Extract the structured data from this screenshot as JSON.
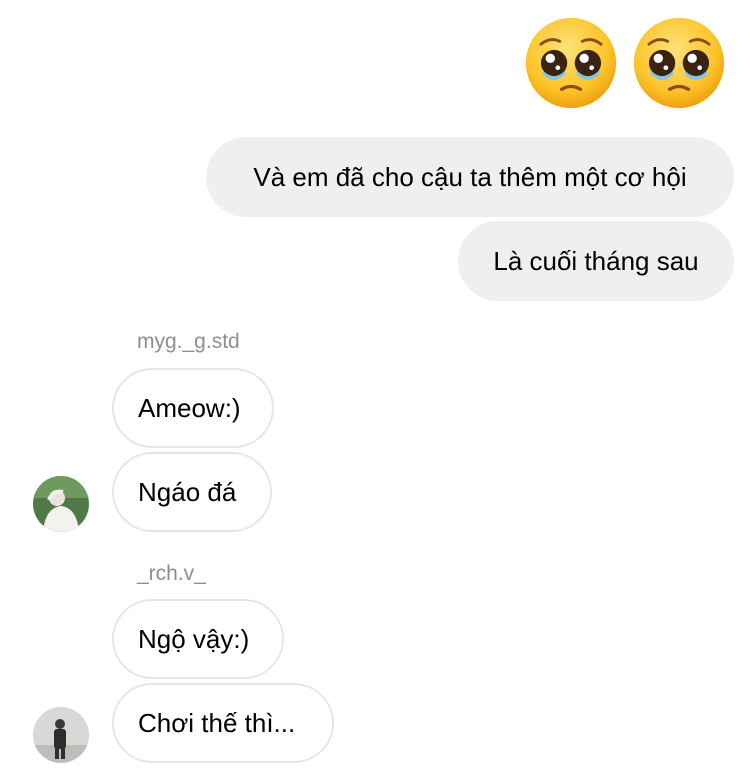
{
  "reactions": {
    "emoji_icons": [
      "pleading-face-icon",
      "pleading-face-icon"
    ]
  },
  "messages": {
    "sent": [
      {
        "text": "Và em đã cho cậu ta thêm một cơ hội"
      },
      {
        "text": "Là cuối tháng sau"
      }
    ],
    "groups": [
      {
        "sender": "myg._g.std",
        "avatar_icon": "avatar-person-white-outfit",
        "bubbles": [
          "Ameow:)",
          "Ngáo đá"
        ]
      },
      {
        "sender": "_rch.v_",
        "avatar_icon": "avatar-person-standing",
        "bubbles": [
          "Ngộ vậy:)",
          "Chơi thế thì..."
        ]
      }
    ]
  },
  "colors": {
    "sent_bubble": "#efefef",
    "received_border": "#e6e6e6",
    "username": "#8e8e8e"
  }
}
